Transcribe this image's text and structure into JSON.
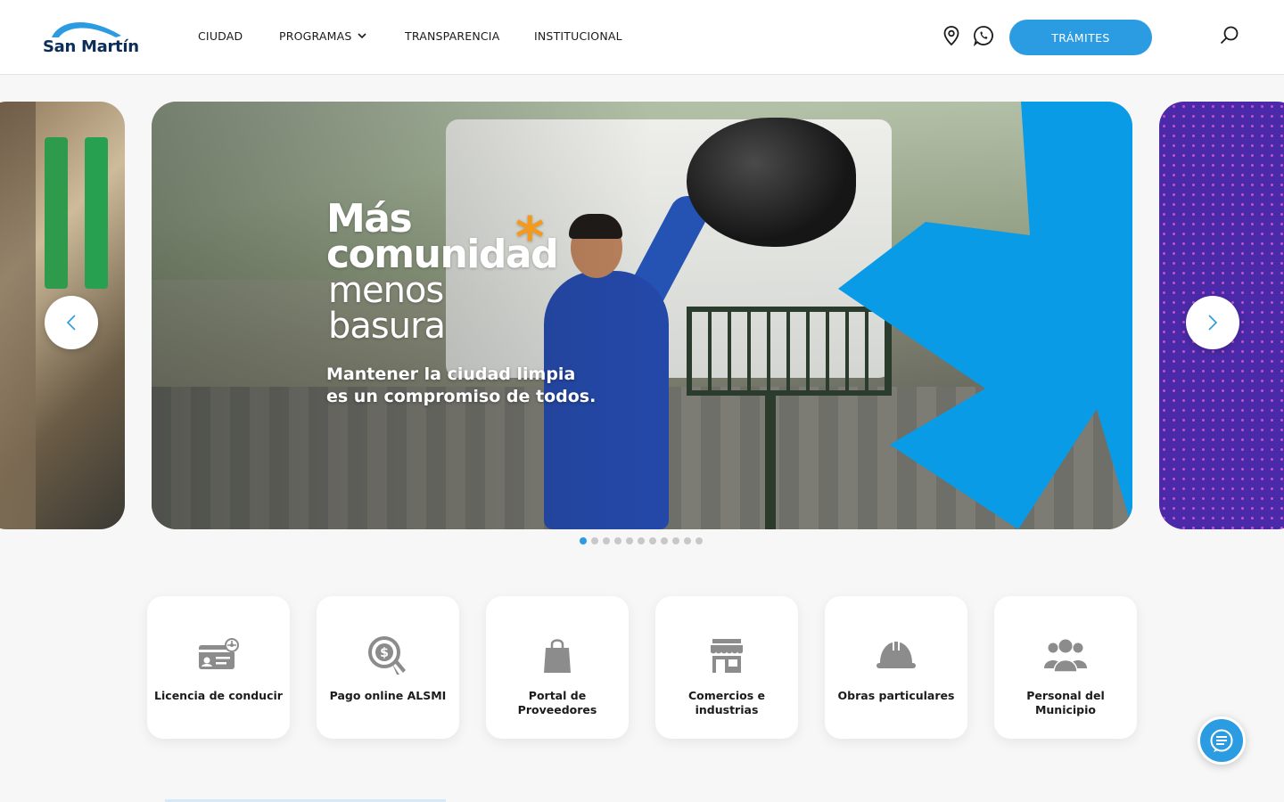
{
  "brand": {
    "name": "San Martín",
    "accent": "#2b9ce2",
    "dark": "#0c2d57"
  },
  "nav": {
    "items": [
      {
        "label": "CIUDAD"
      },
      {
        "label": "PROGRAMAS",
        "has_dropdown": true
      },
      {
        "label": "TRANSPARENCIA"
      },
      {
        "label": "INSTITUCIONAL"
      }
    ]
  },
  "header_icons": [
    "location-pin-icon",
    "whatsapp-icon",
    "search-icon"
  ],
  "tramites_button": {
    "label": "TRÁMITES"
  },
  "carousel": {
    "headline_bold_1": "Más",
    "headline_bold_2": "comunidad",
    "headline_asterisk": "*",
    "headline_light_1": "menos",
    "headline_light_2": "basura",
    "subline_1": "Mantener la ciudad limpia",
    "subline_2": "es un compromiso de todos.",
    "slide_count": 11,
    "active_slide": 1,
    "prev_icon": "chevron-left-icon",
    "next_icon": "chevron-right-icon"
  },
  "quick_access": [
    {
      "label": "Licencia de conducir",
      "icon": "driver-license-icon"
    },
    {
      "label": "Pago online ALSMI",
      "icon": "online-payment-icon"
    },
    {
      "label": "Portal de Proveedores",
      "icon": "shopping-bag-icon"
    },
    {
      "label": "Comercios e industrias",
      "icon": "storefront-icon"
    },
    {
      "label": "Obras particulares",
      "icon": "hard-hat-icon"
    },
    {
      "label": "Personal del Municipio",
      "icon": "people-group-icon"
    }
  ],
  "chat": {
    "icon": "chat-bubble-icon"
  }
}
